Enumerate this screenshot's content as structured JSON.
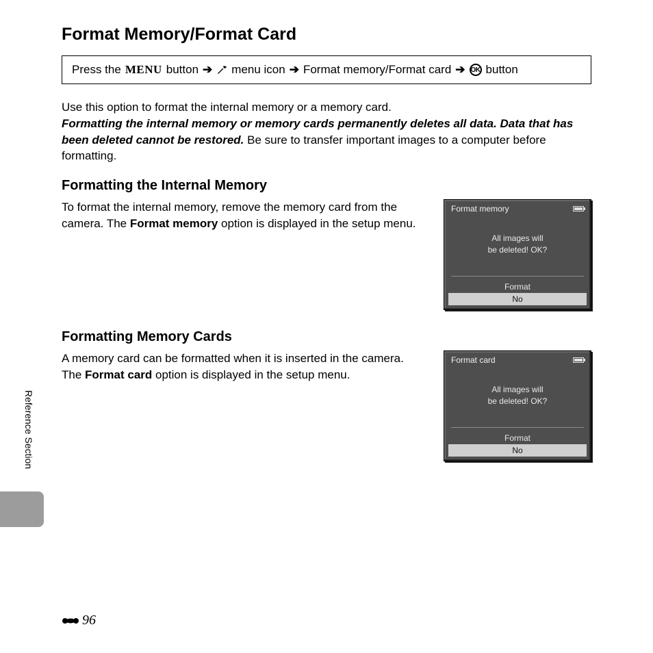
{
  "title": "Format Memory/Format Card",
  "nav": {
    "press": "Press the",
    "menu_word": "MENU",
    "button": "button",
    "menu_icon_text": "menu icon",
    "path_item": "Format memory/Format card",
    "ok_button": "button"
  },
  "intro": {
    "line1": "Use this option to format the internal memory or a memory card.",
    "warn": "Formatting the internal memory or memory cards permanently deletes all data. Data that has been deleted cannot be restored.",
    "after_warn": " Be sure to transfer important images to a computer before formatting."
  },
  "section1": {
    "heading": "Formatting the Internal Memory",
    "pre": "To format the internal memory, remove the memory card from the camera. The ",
    "bold": "Format memory",
    "post": " option is displayed in the setup menu.",
    "screen": {
      "title": "Format memory",
      "msg1": "All images will",
      "msg2": "be deleted! OK?",
      "opt1": "Format",
      "opt2": "No"
    }
  },
  "section2": {
    "heading": "Formatting Memory Cards",
    "pre": "A memory card can be formatted when it is inserted in the camera. The ",
    "bold": "Format card",
    "post": " option is displayed in the setup menu.",
    "screen": {
      "title": "Format card",
      "msg1": "All images will",
      "msg2": "be deleted! OK?",
      "opt1": "Format",
      "opt2": "No"
    }
  },
  "side_label": "Reference Section",
  "page_number": "96"
}
